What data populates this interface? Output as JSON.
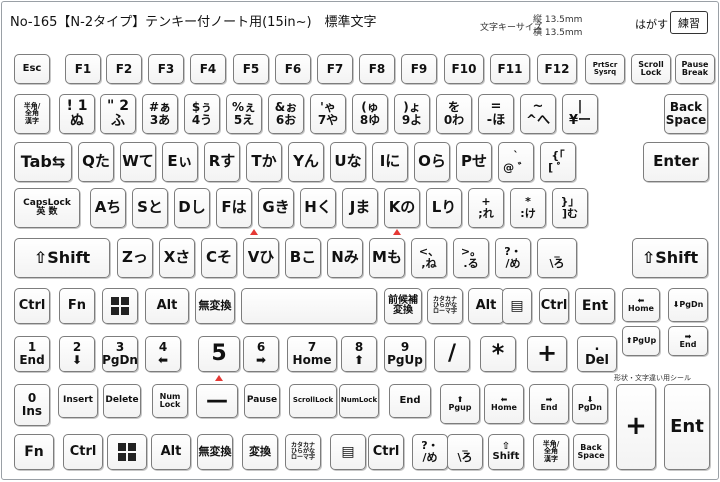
{
  "header": {
    "title": "No-165【N-2タイプ】テンキー付ノート用(15in~)　標準文字",
    "meta_label": "文字キーサイズ",
    "meta_vertical": "縦 13.5mm",
    "meta_horizontal": "横 13.5mm",
    "hagasu": "はがす",
    "practice": "練習",
    "note": "形状・文字違い用シール"
  },
  "colors": {
    "marker": "#e53935",
    "border": "#7d7d7d",
    "text": "#111111"
  },
  "keys": [
    {
      "name": "esc",
      "label": "Esc"
    },
    {
      "name": "f1",
      "label": "F1"
    },
    {
      "name": "f2",
      "label": "F2"
    },
    {
      "name": "f3",
      "label": "F3"
    },
    {
      "name": "f4",
      "label": "F4"
    },
    {
      "name": "f5",
      "label": "F5"
    },
    {
      "name": "f6",
      "label": "F6"
    },
    {
      "name": "f7",
      "label": "F7"
    },
    {
      "name": "f8",
      "label": "F8"
    },
    {
      "name": "f9",
      "label": "F9"
    },
    {
      "name": "f10",
      "label": "F10"
    },
    {
      "name": "f11",
      "label": "F11"
    },
    {
      "name": "f12",
      "label": "F12"
    },
    {
      "name": "prtsc-sysrq",
      "label": "PrtScr\nSysrq"
    },
    {
      "name": "scroll-lock",
      "label": "Scroll\nLock"
    },
    {
      "name": "pause-break",
      "label": "Pause\nBreak"
    },
    {
      "name": "hankaku-zenkaku",
      "label": "半角/\n全角\n漢字"
    },
    {
      "name": "1",
      "label": "! 1ぬ"
    },
    {
      "name": "2",
      "label": "\" 2ふ"
    },
    {
      "name": "3",
      "label": "#ぁ\n3あ"
    },
    {
      "name": "4",
      "label": "$ぅ\n4う"
    },
    {
      "name": "5",
      "label": "%ぇ\n5え"
    },
    {
      "name": "6",
      "label": "&ぉ\n6お"
    },
    {
      "name": "7",
      "label": "'ゃ\n7や"
    },
    {
      "name": "8",
      "label": "(ゅ\n8ゆ"
    },
    {
      "name": "9",
      "label": ")ょ\n9よ"
    },
    {
      "name": "0",
      "label": "を\n0わ"
    },
    {
      "name": "minus",
      "label": "=\n-ほ"
    },
    {
      "name": "caret",
      "label": "~\n^へ"
    },
    {
      "name": "yen",
      "label": "|\n¥ー"
    },
    {
      "name": "backspace",
      "label": "Back\nSpace"
    },
    {
      "name": "tab",
      "label": "Tab⇆"
    },
    {
      "name": "q",
      "label": "Qた"
    },
    {
      "name": "w",
      "label": "Wて"
    },
    {
      "name": "e",
      "label": "Eぃ"
    },
    {
      "name": "r",
      "label": "Rす"
    },
    {
      "name": "t",
      "label": "Tか"
    },
    {
      "name": "y",
      "label": "Yん"
    },
    {
      "name": "u",
      "label": "Uな"
    },
    {
      "name": "i",
      "label": "Iに"
    },
    {
      "name": "o",
      "label": "Oら"
    },
    {
      "name": "p",
      "label": "Pせ"
    },
    {
      "name": "at",
      "label": "`\n@ ゛"
    },
    {
      "name": "bracket-open",
      "label": "{「\n[ ゜"
    },
    {
      "name": "enter",
      "label": "Enter"
    },
    {
      "name": "capslock",
      "label": "CapsLock\n英 数"
    },
    {
      "name": "a",
      "label": "Aち"
    },
    {
      "name": "s",
      "label": "Sと"
    },
    {
      "name": "d",
      "label": "Dし"
    },
    {
      "name": "f",
      "label": "Fは"
    },
    {
      "name": "g",
      "label": "Gき"
    },
    {
      "name": "h",
      "label": "Hく"
    },
    {
      "name": "j",
      "label": "Jま"
    },
    {
      "name": "k",
      "label": "Kの"
    },
    {
      "name": "l",
      "label": "Lり"
    },
    {
      "name": "semicolon",
      "label": "+\n;れ"
    },
    {
      "name": "colon",
      "label": "*\n:け"
    },
    {
      "name": "bracket-close",
      "label": "}」\n]む"
    },
    {
      "name": "shift-left",
      "label": "⇧Shift"
    },
    {
      "name": "z",
      "label": "Zっ"
    },
    {
      "name": "x",
      "label": "Xさ"
    },
    {
      "name": "c",
      "label": "Cそ"
    },
    {
      "name": "v",
      "label": "Vひ"
    },
    {
      "name": "b",
      "label": "Bこ"
    },
    {
      "name": "n",
      "label": "Nみ"
    },
    {
      "name": "m",
      "label": "Mも"
    },
    {
      "name": "comma",
      "label": "<、\n,ね"
    },
    {
      "name": "period",
      "label": ">。\n.る"
    },
    {
      "name": "slash",
      "label": "?・\n/め"
    },
    {
      "name": "backslash",
      "label": "_\n\\ろ"
    },
    {
      "name": "shift-right",
      "label": "⇧Shift"
    },
    {
      "name": "ctrl-left",
      "label": "Ctrl"
    },
    {
      "name": "fn",
      "label": "Fn"
    },
    {
      "name": "win-left",
      "label": ""
    },
    {
      "name": "alt-left",
      "label": "Alt"
    },
    {
      "name": "muhenkan",
      "label": "無変換"
    },
    {
      "name": "space",
      "label": ""
    },
    {
      "name": "henkan",
      "label": "前候補\n変換"
    },
    {
      "name": "kana",
      "label": "カタカナ\nひらがな\nローマ字"
    },
    {
      "name": "alt-right",
      "label": "Alt"
    },
    {
      "name": "menu",
      "label": "▤"
    },
    {
      "name": "ctrl-right",
      "label": "Ctrl"
    },
    {
      "name": "end-key",
      "label": "Ent"
    },
    {
      "name": "home-key",
      "label": "⬅\nHome"
    },
    {
      "name": "pgdn-key",
      "label": "⬇PgDn"
    },
    {
      "name": "pgup-key",
      "label": "⬆PgUp"
    },
    {
      "name": "end-arrow",
      "label": "➡\nEnd"
    },
    {
      "name": "num1",
      "label": "1\nEnd"
    },
    {
      "name": "num2",
      "label": "2\n⬇"
    },
    {
      "name": "num3",
      "label": "3\nPgDn"
    },
    {
      "name": "num4",
      "label": "4\n⬅"
    },
    {
      "name": "num5",
      "label": "5"
    },
    {
      "name": "num6",
      "label": "6\n➡"
    },
    {
      "name": "num7",
      "label": "7\nHome"
    },
    {
      "name": "num8",
      "label": "8\n⬆"
    },
    {
      "name": "num9",
      "label": "9\nPgUp"
    },
    {
      "name": "num-slash",
      "label": "/"
    },
    {
      "name": "num-star",
      "label": "*"
    },
    {
      "name": "num-plus",
      "label": "+"
    },
    {
      "name": "num-del",
      "label": ".\nDel"
    },
    {
      "name": "num0",
      "label": "0\nIns"
    },
    {
      "name": "insert",
      "label": "Insert"
    },
    {
      "name": "delete",
      "label": "Delete"
    },
    {
      "name": "numlock",
      "label": "Num\nLock"
    },
    {
      "name": "num-minus",
      "label": "—"
    },
    {
      "name": "pause",
      "label": "Pause"
    },
    {
      "name": "scrlock",
      "label": "ScrollLock"
    },
    {
      "name": "numlock2",
      "label": "NumLock"
    },
    {
      "name": "end2",
      "label": "End"
    },
    {
      "name": "pgup2",
      "label": "⬆\nPgup"
    },
    {
      "name": "home2",
      "label": "⬅\nHome"
    },
    {
      "name": "end3",
      "label": "➡\nEnd"
    },
    {
      "name": "pgdn2",
      "label": "⬇\nPgDn"
    },
    {
      "name": "plus-big",
      "label": "+"
    },
    {
      "name": "ent-big",
      "label": "Ent"
    },
    {
      "name": "fn-b",
      "label": "Fn"
    },
    {
      "name": "ctrl-b",
      "label": "Ctrl"
    },
    {
      "name": "win-b",
      "label": ""
    },
    {
      "name": "alt-b",
      "label": "Alt"
    },
    {
      "name": "muhenkan-b",
      "label": "無変換"
    },
    {
      "name": "henkan-b",
      "label": "変換"
    },
    {
      "name": "kana-b",
      "label": "カタカナ\nひらがな\nローマ字"
    },
    {
      "name": "menu-b",
      "label": "▤"
    },
    {
      "name": "ctrl-b2",
      "label": "Ctrl"
    },
    {
      "name": "slash-b",
      "label": "?・\n/め"
    },
    {
      "name": "backslash-b",
      "label": "_\n\\ろ"
    },
    {
      "name": "shift-b",
      "label": "⇧\nShift"
    },
    {
      "name": "hankaku-b",
      "label": "半角/\n全角\n漢字"
    },
    {
      "name": "backspace-b",
      "label": "Back\nSpace"
    }
  ]
}
